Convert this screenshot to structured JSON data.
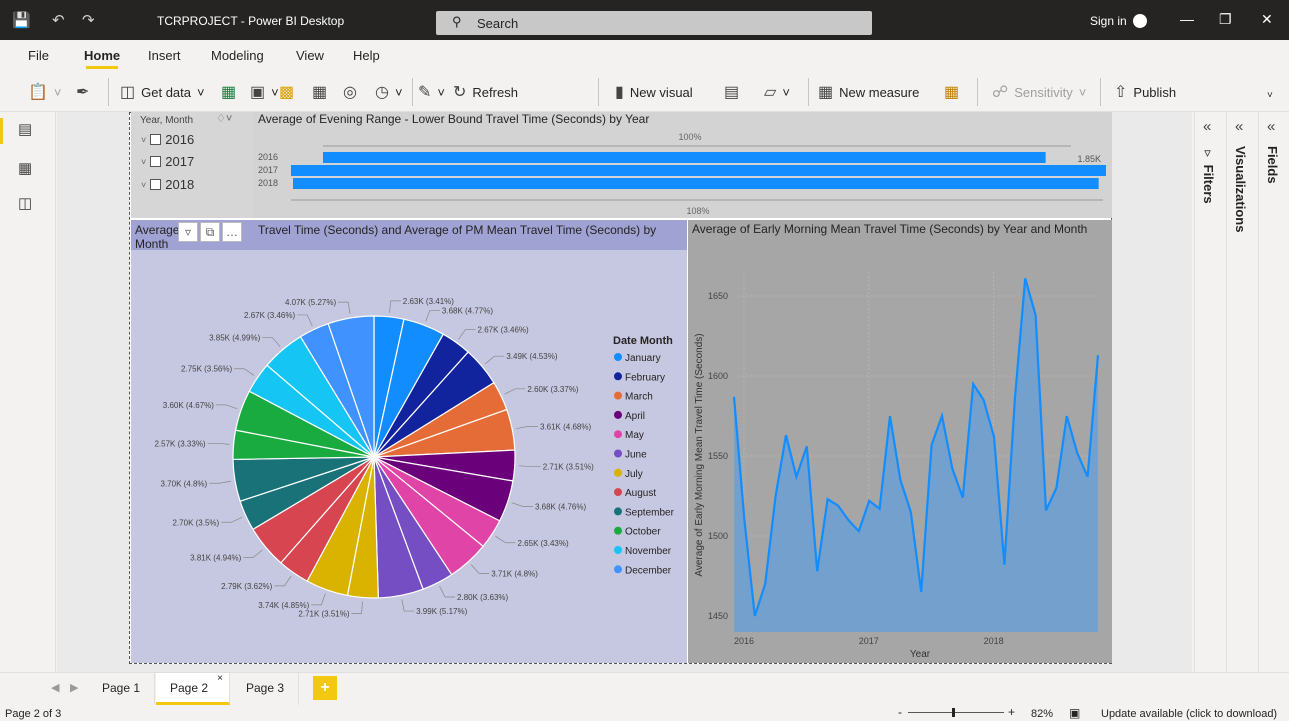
{
  "titlebar": {
    "title": "TCRPROJECT - Power BI Desktop",
    "search_placeholder": "Search",
    "sign_in": "Sign in"
  },
  "menu": {
    "items": [
      "File",
      "Home",
      "Insert",
      "Modeling",
      "View",
      "Help"
    ],
    "active": "Home"
  },
  "ribbon": {
    "get_data": "Get data",
    "refresh": "Refresh",
    "new_visual": "New visual",
    "new_measure": "New measure",
    "sensitivity": "Sensitivity",
    "publish": "Publish"
  },
  "panes": {
    "filters": "Filters",
    "visualizations": "Visualizations",
    "fields": "Fields"
  },
  "slicer": {
    "header": "Year, Month",
    "items": [
      "2016",
      "2017",
      "2018"
    ]
  },
  "bar_visual": {
    "title": "Average of Evening Range - Lower Bound Travel Time (Seconds) by Year",
    "top_label": "100%",
    "bottom_label": "108%",
    "value_label": "1.85K"
  },
  "pie_visual": {
    "title": "Average of AM Mean Travel Time (Seconds) and Average of PM Mean Travel Time (Seconds) by Month",
    "title_visible_start": "Average",
    "title_visible_frag": "Travel Time (Seconds) and Average of PM Mean Travel Time (Seconds) by",
    "title_line2": "Month",
    "legend_title": "Date Month"
  },
  "area_visual": {
    "title": "Average of Early Morning Mean Travel Time (Seconds) by Year and Month",
    "xlabel": "Year",
    "ylabel": "Average of Early Morning Mean Travel Time (Seconds)"
  },
  "tabs": [
    "Page 1",
    "Page 2",
    "Page 3"
  ],
  "active_tab": "Page 2",
  "status": {
    "page": "Page 2 of 3",
    "zoom": "82%",
    "update": "Update available (click to download)"
  },
  "chart_data": [
    {
      "type": "bar",
      "title": "Average of Evening Range - Lower Bound Travel Time (Seconds) by Year",
      "categories": [
        "2016",
        "2017",
        "2018"
      ],
      "values": [
        1850,
        1998,
        1980
      ],
      "data_labels": [
        "1.85K"
      ],
      "reference_labels": [
        "100%",
        "108%"
      ],
      "color": "#118DFF"
    },
    {
      "type": "pie",
      "title": "Average of AM Mean Travel Time (Seconds) and Average of PM Mean Travel Time (Seconds) by Month",
      "legend_title": "Date Month",
      "legend": [
        {
          "name": "January",
          "color": "#118DFF"
        },
        {
          "name": "February",
          "color": "#12239E"
        },
        {
          "name": "March",
          "color": "#E66C37"
        },
        {
          "name": "April",
          "color": "#6B007B"
        },
        {
          "name": "May",
          "color": "#E044A7"
        },
        {
          "name": "June",
          "color": "#744EC2"
        },
        {
          "name": "July",
          "color": "#D9B300"
        },
        {
          "name": "August",
          "color": "#D64550"
        },
        {
          "name": "September",
          "color": "#197278"
        },
        {
          "name": "October",
          "color": "#1AAB40"
        },
        {
          "name": "November",
          "color": "#15C6F4"
        },
        {
          "name": "December",
          "color": "#4092FF"
        }
      ],
      "slices": [
        {
          "label": "2.63K (3.41%)",
          "pct": 3.41,
          "color": "#118DFF"
        },
        {
          "label": "3.68K (4.77%)",
          "pct": 4.77,
          "color": "#118DFF"
        },
        {
          "label": "2.67K (3.46%)",
          "pct": 3.46,
          "color": "#12239E"
        },
        {
          "label": "3.49K (4.53%)",
          "pct": 4.53,
          "color": "#12239E"
        },
        {
          "label": "2.60K (3.37%)",
          "pct": 3.37,
          "color": "#E66C37"
        },
        {
          "label": "3.61K (4.68%)",
          "pct": 4.68,
          "color": "#E66C37"
        },
        {
          "label": "2.71K (3.51%)",
          "pct": 3.51,
          "color": "#6B007B"
        },
        {
          "label": "3.68K (4.76%)",
          "pct": 4.76,
          "color": "#6B007B"
        },
        {
          "label": "2.65K (3.43%)",
          "pct": 3.43,
          "color": "#E044A7"
        },
        {
          "label": "3.71K (4.8%)",
          "pct": 4.8,
          "color": "#E044A7"
        },
        {
          "label": "2.80K (3.63%)",
          "pct": 3.63,
          "color": "#744EC2"
        },
        {
          "label": "3.99K (5.17%)",
          "pct": 5.17,
          "color": "#744EC2"
        },
        {
          "label": "2.71K (3.51%)",
          "pct": 3.51,
          "color": "#D9B300"
        },
        {
          "label": "3.74K (4.85%)",
          "pct": 4.85,
          "color": "#D9B300"
        },
        {
          "label": "2.79K (3.62%)",
          "pct": 3.62,
          "color": "#D64550"
        },
        {
          "label": "3.81K (4.94%)",
          "pct": 4.94,
          "color": "#D64550"
        },
        {
          "label": "2.70K (3.5%)",
          "pct": 3.5,
          "color": "#197278"
        },
        {
          "label": "3.70K (4.8%)",
          "pct": 4.8,
          "color": "#197278"
        },
        {
          "label": "2.57K (3.33%)",
          "pct": 3.33,
          "color": "#1AAB40"
        },
        {
          "label": "3.60K (4.67%)",
          "pct": 4.67,
          "color": "#1AAB40"
        },
        {
          "label": "2.75K (3.56%)",
          "pct": 3.56,
          "color": "#15C6F4"
        },
        {
          "label": "3.85K (4.99%)",
          "pct": 4.99,
          "color": "#15C6F4"
        },
        {
          "label": "2.67K (3.46%)",
          "pct": 3.46,
          "color": "#4092FF"
        },
        {
          "label": "4.07K (5.27%)",
          "pct": 5.27,
          "color": "#4092FF"
        }
      ]
    },
    {
      "type": "area",
      "title": "Average of Early Morning Mean Travel Time (Seconds) by Year and Month",
      "xlabel": "Year",
      "ylabel": "Average of Early Morning Mean Travel Time (Seconds)",
      "x_ticks": [
        "2016",
        "2017",
        "2018"
      ],
      "y_ticks": [
        1450,
        1500,
        1550,
        1600,
        1650
      ],
      "ylim": [
        1440,
        1665
      ],
      "color": "#118DFF",
      "values": [
        1587,
        1510,
        1450,
        1470,
        1525,
        1563,
        1537,
        1556,
        1478,
        1523,
        1519,
        1510,
        1503,
        1522,
        1517,
        1575,
        1535,
        1515,
        1465,
        1557,
        1575,
        1542,
        1524,
        1595,
        1585,
        1562,
        1482,
        1585,
        1661,
        1638,
        1516,
        1530,
        1575,
        1552,
        1537,
        1613
      ]
    }
  ]
}
